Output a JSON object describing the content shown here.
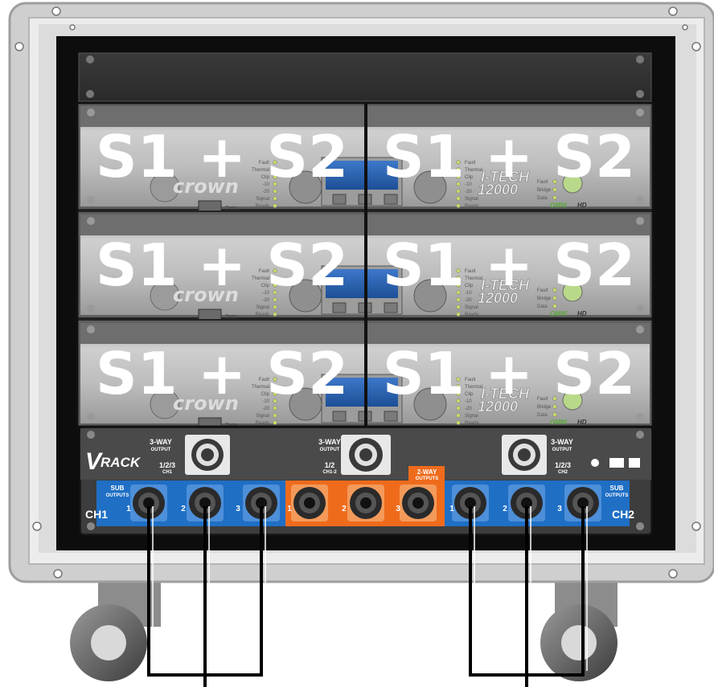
{
  "amps": [
    {
      "row": 1,
      "side": "left",
      "label": "S1 + S2"
    },
    {
      "row": 1,
      "side": "right",
      "label": "S1 + S2"
    },
    {
      "row": 2,
      "side": "left",
      "label": "S1 + S2"
    },
    {
      "row": 2,
      "side": "right",
      "label": "S1 + S2"
    },
    {
      "row": 3,
      "side": "left",
      "label": "S1 + S2"
    },
    {
      "row": 3,
      "side": "right",
      "label": "S1 + S2"
    }
  ],
  "amp_panel": {
    "brand": "crown",
    "model_line1": "I-TECH",
    "model_line2": "12000",
    "series": "OMNI",
    "series_suffix": "HD",
    "data_label": "Data",
    "left_leds": [
      "Fault",
      "Thermal",
      "Clip",
      "-10",
      "-20",
      "Signal",
      "Ready"
    ],
    "right_leds": [
      "Fault",
      "Bridge",
      "Data"
    ]
  },
  "patch_panel": {
    "logo": "RACK",
    "logo_v": "V",
    "out_left_title": "3-WAY",
    "out_left_sub": "OUTPUT",
    "out_left_ch": "1/2/3",
    "out_left_chname": "CH1",
    "out_mid_title": "3-WAY",
    "out_mid_sub": "OUTPUT",
    "out_mid_ch": "1/2",
    "out_mid_chname": "CH1-2",
    "out_right_title": "3-WAY",
    "out_right_sub": "OUTPUT",
    "out_right_ch": "1/2/3",
    "out_right_chname": "CH2",
    "two_way_title": "2-WAY",
    "two_way_sub": "OUTPUTS",
    "sub_left_title": "SUB",
    "sub_left_sub": "OUTPUTS",
    "sub_right_title": "SUB",
    "sub_right_sub": "OUTPUTS",
    "ch1": "CH1",
    "ch2": "CH2",
    "jack_numbers": [
      "1",
      "2",
      "3"
    ],
    "colors": {
      "sub": "#1f6fc5",
      "two_way": "#ef6b1c",
      "panel": "#3d3d3d"
    }
  }
}
